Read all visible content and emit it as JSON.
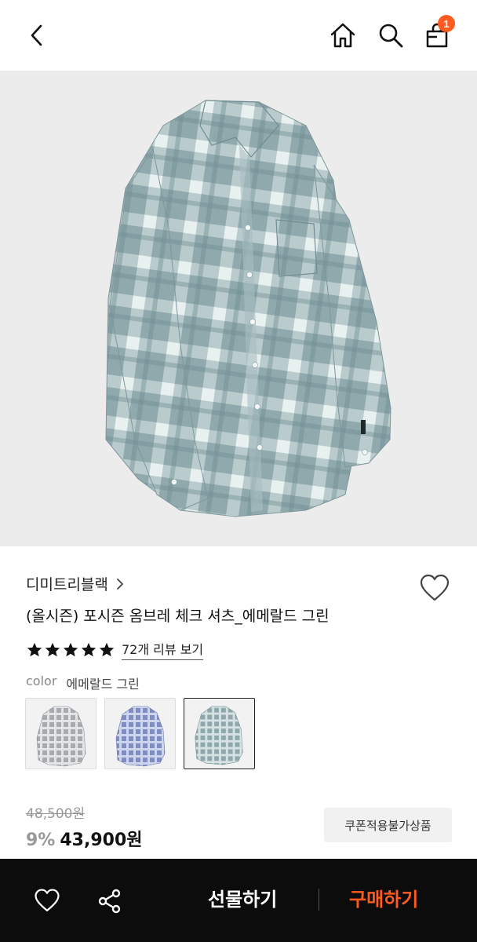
{
  "header": {
    "cart_count": "1"
  },
  "product": {
    "brand": "디미트리블랙",
    "title": "(올시즌) 포시즌 옴브레 체크 셔츠_에메랄드 그린",
    "rating_stars": 5,
    "review_link": "72개 리뷰 보기",
    "color_label": "color",
    "color_value": "에메랄드 그린",
    "swatches": [
      {
        "name": "gray",
        "color": "#b9bcbf"
      },
      {
        "name": "blue",
        "color": "#8d9ac9"
      },
      {
        "name": "emerald green",
        "color": "#9eb3b4",
        "selected": true
      }
    ],
    "original_price": "48,500원",
    "discount": "9%",
    "price": "43,900원",
    "coupon_label": "쿠폰적용불가상품"
  },
  "bottom_bar": {
    "gift_label": "선물하기",
    "buy_label": "구매하기"
  },
  "colors": {
    "accent": "#ff5a1f",
    "bottom_bar_bg": "#0c0c0c",
    "shirt_base": "#8fa9ad"
  }
}
